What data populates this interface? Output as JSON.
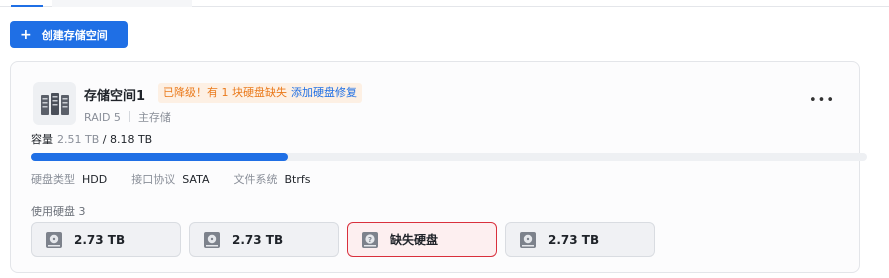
{
  "toolbar": {
    "create_label": "创建存储空间",
    "accent": "#1f6fe5"
  },
  "pool": {
    "name": "存储空间1",
    "status_warning": "已降级！有 1 块硬盘缺失",
    "status_action": "添加硬盘修复",
    "raid": "RAID 5",
    "role": "主存储",
    "capacity_label": "容量",
    "used": "2.51 TB",
    "total": "/ 8.18 TB",
    "usage_fraction": 0.307,
    "props": {
      "disk_type_label": "硬盘类型",
      "disk_type": "HDD",
      "interface_label": "接口协议",
      "interface": "SATA",
      "fs_label": "文件系统",
      "fs": "Btrfs"
    },
    "disks_label": "使用硬盘 3",
    "disks": [
      {
        "label": "2.73 TB",
        "icon": "hard-drive-icon"
      },
      {
        "label": "2.73 TB",
        "icon": "hard-drive-icon"
      },
      {
        "label": "缺失硬盘",
        "icon": "missing-drive-icon"
      },
      {
        "label": "2.73 TB",
        "icon": "hard-drive-icon"
      }
    ],
    "colors": {
      "warning": "#ea7a1c",
      "missing_border": "#d9303d"
    }
  }
}
